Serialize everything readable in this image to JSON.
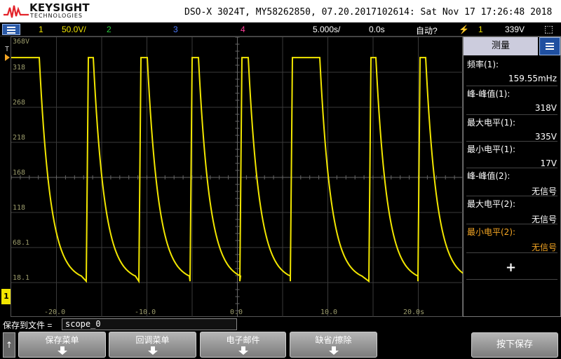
{
  "header": {
    "brand": "KEYSIGHT",
    "brand_sub": "TECHNOLOGIES",
    "info": "DSO-X 3024T, MY58262850, 07.20.2017102614: Sat Nov 17 17:26:48 2018"
  },
  "status": {
    "ch1_num": "1",
    "ch1_scale": "50.0V/",
    "ch2_num": "2",
    "ch3_num": "3",
    "ch4_num": "4",
    "timebase": "5.000s/",
    "delay": "0.0s",
    "trigger_mode": "自动?",
    "trigger_source": "1",
    "trigger_level": "339V"
  },
  "colors": {
    "ch1": "#f2e600",
    "ch2": "#2ecc40",
    "ch3": "#4f7cff",
    "ch4": "#ff3d9a",
    "highlight": "#f5a623"
  },
  "graticule": {
    "y_labels": [
      "368V",
      "318",
      "268",
      "218",
      "168",
      "118",
      "68.1",
      "18.1"
    ],
    "x_labels": [
      "-20.0",
      "-10.0",
      "0.0",
      "10.0",
      "20.0s"
    ],
    "trigger_marker": "T",
    "ch1_marker": "1"
  },
  "waveform": {
    "channel": 1,
    "high_v": 335,
    "low_v": 17,
    "frequency": "159.55mHz"
  },
  "panel": {
    "title": "测量",
    "icon": "menu-icon",
    "measurements": [
      {
        "name": "频率(1):",
        "value": "159.55mHz"
      },
      {
        "name": "峰-峰值(1):",
        "value": "318V"
      },
      {
        "name": "最大电平(1):",
        "value": "335V"
      },
      {
        "name": "最小电平(1):",
        "value": "17V"
      },
      {
        "name": "峰-峰值(2):",
        "value": "无信号"
      },
      {
        "name": "最大电平(2):",
        "value": "无信号"
      },
      {
        "name": "最小电平(2):",
        "value": "无信号"
      }
    ],
    "add_label": "+"
  },
  "bottom": {
    "save_label": "保存到文件 =",
    "filename": "scope_0",
    "up_label": "↑",
    "softkeys": [
      "保存菜单",
      "回调菜单",
      "电子邮件",
      "缺省/擦除"
    ],
    "save_press": "按下保存"
  }
}
